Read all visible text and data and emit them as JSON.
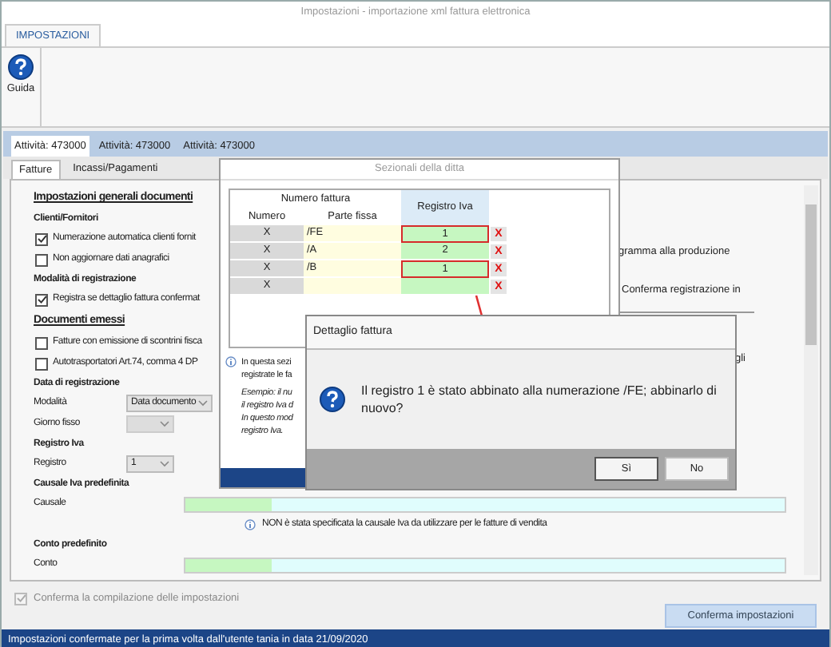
{
  "window": {
    "title": "Impostazioni - importazione xml fattura elettronica"
  },
  "ribbon": {
    "tabs": [
      {
        "label": "IMPOSTAZIONI",
        "selected": true
      }
    ],
    "buttons": [
      {
        "label": "Guida"
      }
    ]
  },
  "activity_tabs": [
    {
      "label": "Attività: 473000",
      "selected": true
    },
    {
      "label": "Attività: 473000",
      "selected": false
    },
    {
      "label": "Attività: 473000",
      "selected": false
    }
  ],
  "sub_tabs": [
    {
      "label": "Fatture",
      "selected": true
    },
    {
      "label": "Incassi/Pagamenti",
      "selected": false
    }
  ],
  "settings": [
    {
      "kind": "section",
      "text": "Impostazioni generali documenti"
    },
    {
      "kind": "group",
      "text": "Clienti/Fornitori"
    },
    {
      "kind": "checkbox",
      "label": "Numerazione automatica clienti fornit",
      "checked": true
    },
    {
      "kind": "checkbox",
      "label": "Non aggiornare dati anagrafici",
      "checked": false
    },
    {
      "kind": "group",
      "text": "Modalità di registrazione"
    },
    {
      "kind": "checkbox",
      "label": "Registra se dettaglio fattura confermat",
      "checked": true
    },
    {
      "kind": "section",
      "text": "Documenti emessi"
    },
    {
      "kind": "checkbox",
      "label": "Fatture con emissione di scontrini fisca",
      "checked": false
    },
    {
      "kind": "checkbox",
      "label": "Autotrasportatori Art.74, comma 4 DP",
      "checked": false
    },
    {
      "kind": "group",
      "text": "Data di registrazione"
    },
    {
      "kind": "select",
      "label": "Modalità",
      "value": "Data documento",
      "disabled": false
    },
    {
      "kind": "select",
      "label": "Giorno fisso",
      "disabled": true
    },
    {
      "kind": "group",
      "text": "Registro Iva"
    },
    {
      "kind": "select",
      "label": "Registro",
      "value": "1",
      "disabled": false
    },
    {
      "kind": "group",
      "text": "Causale Iva predefinita"
    },
    {
      "kind": "field",
      "label": "Causale"
    },
    {
      "kind": "note",
      "text": "NON è stata specificata la causale Iva da utilizzare per le fatture di vendita"
    },
    {
      "kind": "group",
      "text": "Conto predefinito"
    },
    {
      "kind": "field",
      "label": "Conto"
    }
  ],
  "right_column": [
    "gramma alla produzione",
    "Conferma registrazione in",
    "gli"
  ],
  "confirm_checkbox": {
    "label": "Conferma la compilazione delle impostazioni",
    "checked": true,
    "disabled": true
  },
  "confirm_button": "Conferma impostazioni",
  "status_bar": "Impostazioni confermate per la prima volta dall'utente tania in data 21/09/2020",
  "sezionali": {
    "title": "Sezionali della ditta",
    "group_header": "Numero fattura",
    "columns": [
      "Numero",
      "Parte fissa",
      "Registro Iva"
    ],
    "rows": [
      {
        "numero": "X",
        "parte_fissa": "/FE",
        "registro": "1",
        "highlighted": true,
        "delete": "X"
      },
      {
        "numero": "X",
        "parte_fissa": "/A",
        "registro": "2",
        "highlighted": false,
        "delete": "X"
      },
      {
        "numero": "X",
        "parte_fissa": "/B",
        "registro": "1",
        "highlighted": true,
        "delete": "X"
      },
      {
        "numero": "X",
        "parte_fissa": "",
        "registro": "",
        "highlighted": false,
        "delete": "X"
      }
    ],
    "note_lines": [
      "In questa sezi",
      "registrate le fa"
    ],
    "example_lines": [
      "*Esempio:* il nu",
      "il registro Iva d",
      "In questo mod",
      "registro Iva."
    ]
  },
  "dialog": {
    "title": "Dettaglio fattura",
    "message": "Il registro 1 è stato abbinato alla numerazione /FE; abbinarlo di nuovo?",
    "buttons": [
      "Sì",
      "No"
    ]
  }
}
